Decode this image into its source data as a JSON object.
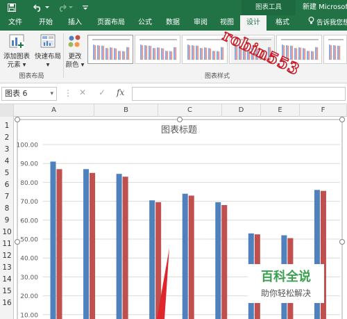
{
  "titlebar": {
    "save_icon": "save-icon",
    "undo_icon": "undo-icon",
    "redo_icon": "redo-icon",
    "customize_icon": "customize-qat-icon",
    "context_tab": "图表工具",
    "doc_title": "新建 Microsoft"
  },
  "tabs": [
    "文件",
    "开始",
    "插入",
    "页面布局",
    "公式",
    "数据",
    "审阅",
    "视图",
    "设计",
    "格式"
  ],
  "tell_me": "告诉我您想",
  "ribbon": {
    "add_element_line1": "添加图表",
    "add_element_line2": "元素",
    "quick_layout": "快速布局",
    "change_color_line1": "更改",
    "change_color_line2": "颜色",
    "group_layout": "图表布局",
    "group_styles": "图表样式"
  },
  "overlay_text": "robin553",
  "formula": {
    "name_box": "图表 6",
    "cancel": "✕",
    "enter": "✓",
    "fx": "fx",
    "value": ""
  },
  "columns": [
    "A",
    "B",
    "C",
    "D",
    "E",
    "F"
  ],
  "rows": [
    "1",
    "2",
    "3",
    "4",
    "5",
    "6",
    "7",
    "8",
    "9",
    "10",
    "11",
    "12",
    "13",
    "14",
    "15",
    "16"
  ],
  "watermark": {
    "title": "百科全说",
    "subtitle": "助你轻松解决"
  },
  "colors": {
    "excel_green": "#217346",
    "series1": "#4f81bd",
    "series2": "#c0504d",
    "annotation": "#e0252c"
  },
  "chart_data": {
    "type": "bar",
    "title": "图表标题",
    "ylim": [
      0,
      100
    ],
    "yticks": [
      "100.00",
      "90.00",
      "80.00",
      "70.00",
      "60.00",
      "50.00",
      "40.00",
      "30.00",
      "20.00",
      "10.00"
    ],
    "grid": true,
    "series": [
      {
        "values": [
          91,
          87,
          84.5,
          70.5,
          74,
          69.5,
          53,
          52,
          76
        ]
      },
      {
        "values": [
          87,
          85,
          83,
          69.5,
          73,
          68,
          52.5,
          50.5,
          75.5
        ]
      }
    ]
  }
}
